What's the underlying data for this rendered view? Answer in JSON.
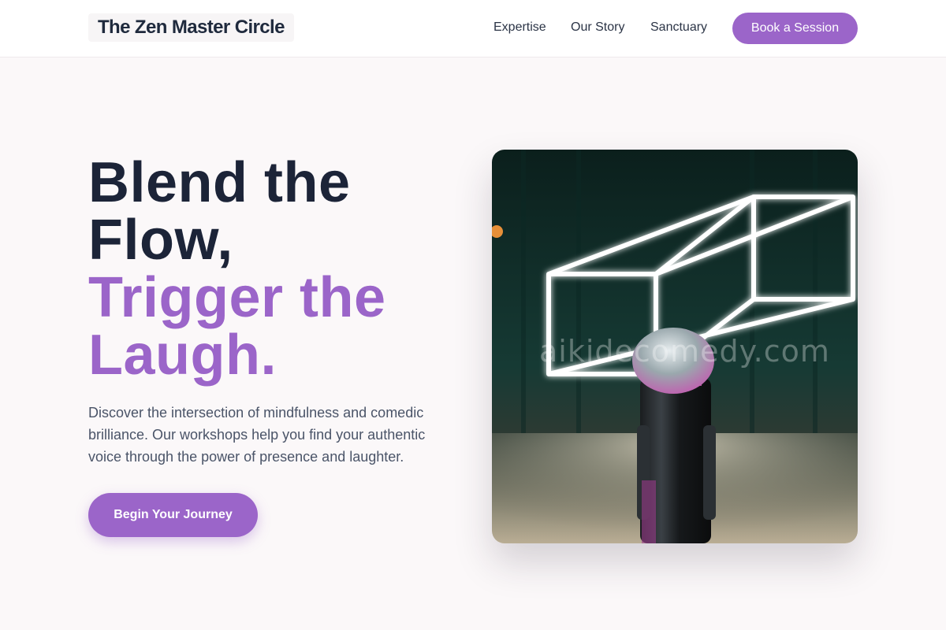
{
  "header": {
    "logo": "The Zen Master Circle",
    "nav": [
      {
        "label": "Expertise"
      },
      {
        "label": "Our Story"
      },
      {
        "label": "Sanctuary"
      }
    ],
    "cta_label": "Book a Session"
  },
  "hero": {
    "title_dark_1": "Blend the",
    "title_dark_2": "Flow,",
    "title_accent_1": "Trigger the",
    "title_accent_2": "Laugh.",
    "description": "Discover the intersection of mindfulness and comedic brilliance. Our workshops help you find your authentic voice through the power of presence and laughter.",
    "cta_label": "Begin Your Journey",
    "image_watermark": "aikidecomedy.com"
  },
  "colors": {
    "accent": "#9b65c9",
    "heading": "#1c2438",
    "background": "#fbf8f9"
  },
  "icons": [
    "neon-cube-sculpture",
    "microphone"
  ]
}
